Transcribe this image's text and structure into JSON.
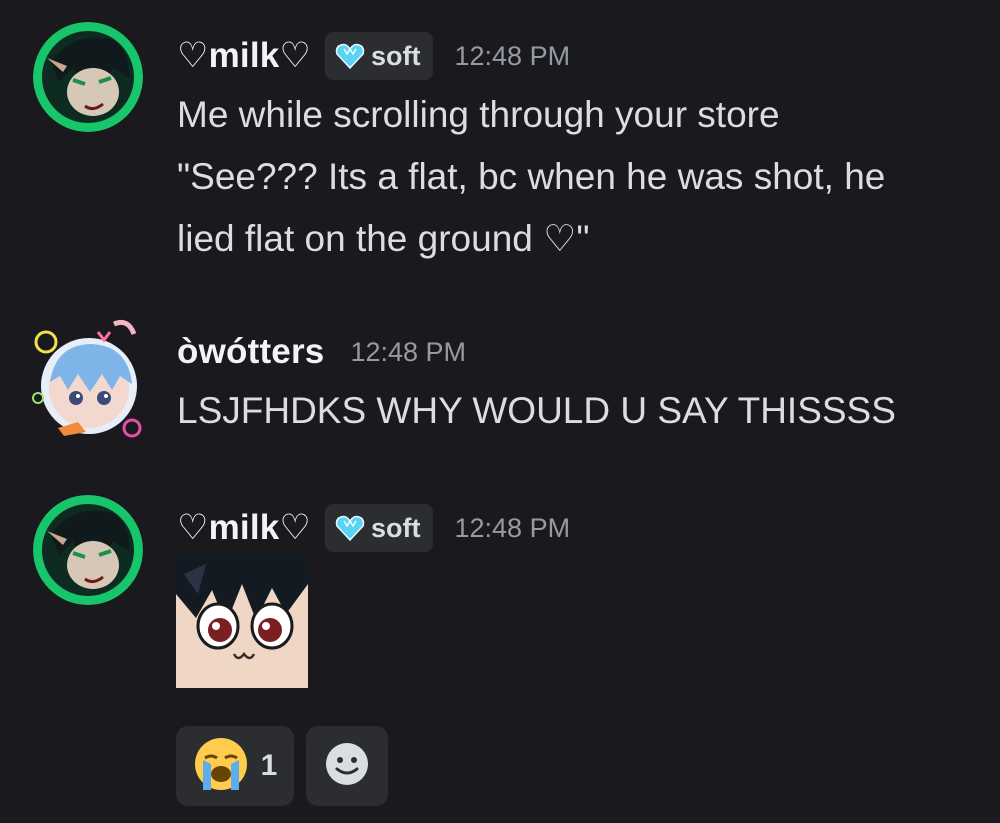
{
  "messages": [
    {
      "author": "♡milk♡",
      "tag": "soft",
      "timestamp": "12:48 PM",
      "lines": [
        "Me while scrolling through your store",
        "\"See??? Its a flat, bc when he was shot, he",
        "lied flat on the ground ♡\""
      ]
    },
    {
      "author": "òwótters",
      "timestamp": "12:48 PM",
      "lines": [
        "LSJFHDKS WHY WOULD U SAY THISSSS"
      ]
    },
    {
      "author": "♡milk♡",
      "tag": "soft",
      "timestamp": "12:48 PM"
    }
  ],
  "reactions": [
    {
      "emoji": "crying-face-emoji",
      "count": "1"
    },
    {
      "emoji": "add-reaction-icon"
    }
  ],
  "colors": {
    "background": "#1a1a1e",
    "text": "#dbdee1",
    "username": "#f2f3f5",
    "timestamp": "#949ba4",
    "tag_bg": "#2b2d31",
    "tag_gem": "#5ad4f5"
  }
}
